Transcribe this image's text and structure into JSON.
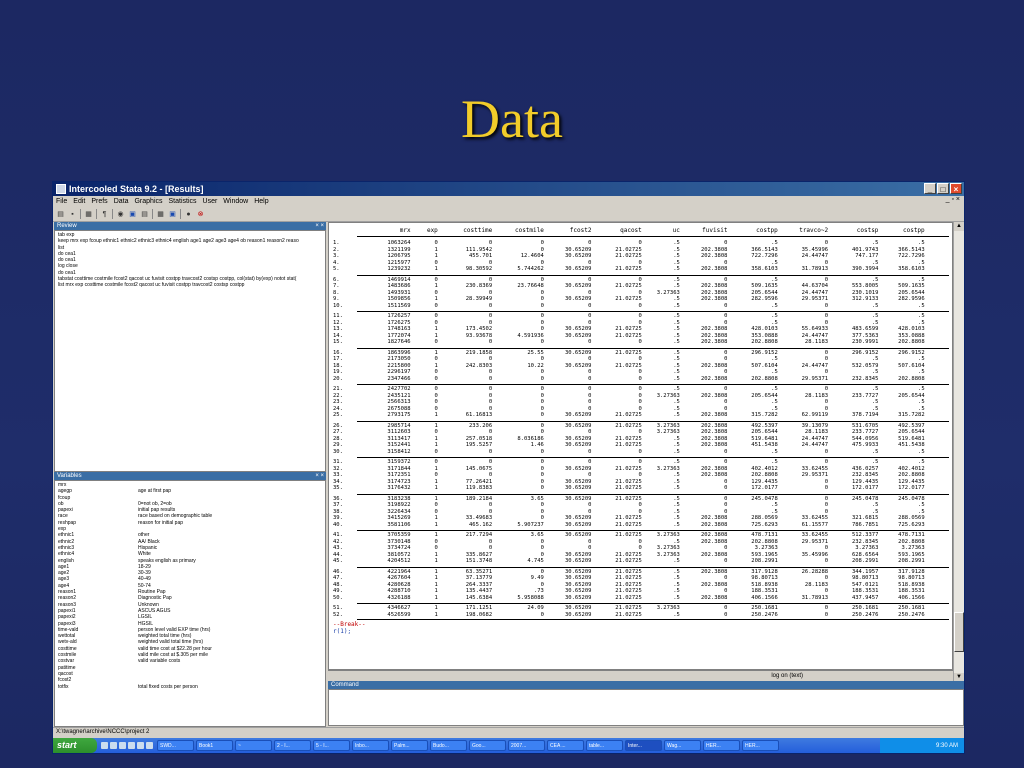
{
  "slide": {
    "title": "Data"
  },
  "window": {
    "title": "Intercooled Stata 9.2 - [Results]"
  },
  "menu": [
    "File",
    "Edit",
    "Prefs",
    "Data",
    "Graphics",
    "Statistics",
    "User",
    "Window",
    "Help"
  ],
  "review": {
    "title": "Review",
    "lines": [
      "tab exp",
      "keep mrx exp fcoup ethnic1 ethnic2 ethnic3 ethnic4 english age1 age2 age3 age4 ob reason1 reason2 reaso",
      "list",
      "do cea1",
      "do cea1",
      "log close",
      "do cea1",
      "tabstat costtime costmile fcost2 qacost uc fuvisit costpp travcost2 costsp costpp, col(stat) by(exp) notot stat(",
      "list mrx exp costtime costmile fcost2 qacost uc fuvisit costpp travcost2 costsp costpp"
    ]
  },
  "variables": {
    "title": "Variables",
    "rows": [
      [
        "mrx",
        ""
      ],
      [
        "agegp",
        "age at first pap"
      ],
      [
        "fcoup",
        ""
      ],
      [
        "ob",
        "0=not ob, 2=ob"
      ],
      [
        "papexi",
        "initial pap results"
      ],
      [
        "race",
        "race based on demographic table"
      ],
      [
        "reshpap",
        "reason for initial pap"
      ],
      [
        "exp",
        ""
      ],
      [
        "ethnic1",
        "other"
      ],
      [
        "ethnic2",
        "AA/ Black"
      ],
      [
        "ethnic3",
        "Hispanic"
      ],
      [
        "ethnic4",
        "White"
      ],
      [
        "english",
        "speaks english as primary"
      ],
      [
        "age1",
        "18-29"
      ],
      [
        "age2",
        "30-39"
      ],
      [
        "age3",
        "40-49"
      ],
      [
        "age4",
        "50-74"
      ],
      [
        "reason1",
        "Routine Pap"
      ],
      [
        "reason2",
        "Diagnostic Pap"
      ],
      [
        "reason3",
        "Unknown"
      ],
      [
        "papexi1",
        "ASCUS AGUS"
      ],
      [
        "papexi2",
        "LGSIL"
      ],
      [
        "papexi3",
        "HGSIL"
      ],
      [
        "time-vald",
        "person level valid EXP time (hrs)"
      ],
      [
        "wettotal",
        "weighted total time (hrs)"
      ],
      [
        "wetv-ald",
        "weighted valid total time (hrs)"
      ],
      [
        "costtime",
        "valid time cost at $22.28 per hour"
      ],
      [
        "costmile",
        "valid mile cost at $.305 per mile"
      ],
      [
        "costvar",
        "valid variable costs"
      ],
      [
        "patitime",
        ""
      ],
      [
        "qacost",
        ""
      ],
      [
        "fcost2",
        ""
      ],
      [
        "totfix",
        "total fixed costs per person"
      ]
    ]
  },
  "results": {
    "columns": [
      "mrx",
      "exp",
      "costtime",
      "costmile",
      "fcost2",
      "qacost",
      "uc",
      "fuvisit",
      "costpp",
      "travco~2",
      "costsp",
      "costpp"
    ],
    "rows": [
      [
        "1.",
        "1063264",
        "0",
        "0",
        "0",
        "0",
        "0",
        ".5",
        "0",
        ".5",
        "0",
        ".5",
        ".5"
      ],
      [
        "2.",
        "1321199",
        "1",
        "111.9542",
        "0",
        "30.65209",
        "21.02725",
        ".5",
        "202.3808",
        "366.5143",
        "35.45996",
        "401.9743",
        "366.5143"
      ],
      [
        "3.",
        "1206795",
        "1",
        "455.701",
        "12.4604",
        "30.65209",
        "21.02725",
        ".5",
        "202.3808",
        "722.7296",
        "24.44747",
        "747.177",
        "722.7296"
      ],
      [
        "4.",
        "1215977",
        "0",
        "0",
        "0",
        "0",
        "0",
        ".5",
        "0",
        ".5",
        "0",
        ".5",
        ".5"
      ],
      [
        "5.",
        "1239232",
        "1",
        "98.30592",
        "5.744262",
        "30.65209",
        "21.02725",
        ".5",
        "202.3808",
        "358.6103",
        "31.78913",
        "390.3994",
        "358.6103"
      ],
      [
        "6.",
        "1469914",
        "0",
        "0",
        "0",
        "0",
        "0",
        ".5",
        "0",
        ".5",
        "0",
        ".5",
        ".5"
      ],
      [
        "7.",
        "1483686",
        "1",
        "230.8369",
        "23.76648",
        "30.65209",
        "21.02725",
        ".5",
        "202.3808",
        "509.1635",
        "44.63704",
        "553.8005",
        "509.1635"
      ],
      [
        "8.",
        "1493931",
        "0",
        "0",
        "0",
        "0",
        "0",
        "3.27363",
        "202.3808",
        "205.6544",
        "24.44747",
        "230.1019",
        "205.6544"
      ],
      [
        "9.",
        "1509856",
        "1",
        "28.39949",
        "0",
        "30.65209",
        "21.02725",
        ".5",
        "202.3808",
        "282.9596",
        "29.95371",
        "312.9133",
        "282.9596"
      ],
      [
        "10.",
        "1511569",
        "0",
        "0",
        "0",
        "0",
        "0",
        ".5",
        "0",
        ".5",
        "0",
        ".5",
        ".5"
      ],
      [
        "11.",
        "1726257",
        "0",
        "0",
        "0",
        "0",
        "0",
        ".5",
        "0",
        ".5",
        "0",
        ".5",
        ".5"
      ],
      [
        "12.",
        "1726275",
        "0",
        "0",
        "0",
        "0",
        "0",
        ".5",
        "0",
        ".5",
        "0",
        ".5",
        ".5"
      ],
      [
        "13.",
        "1748163",
        "1",
        "173.4502",
        "0",
        "30.65209",
        "21.02725",
        ".5",
        "202.3808",
        "428.0103",
        "55.64933",
        "483.6599",
        "428.0103"
      ],
      [
        "14.",
        "1772074",
        "1",
        "93.93678",
        "4.591936",
        "30.65209",
        "21.02725",
        ".5",
        "202.3808",
        "353.0888",
        "24.44747",
        "377.5363",
        "353.0888"
      ],
      [
        "15.",
        "1827646",
        "0",
        "0",
        "0",
        "0",
        "0",
        ".5",
        "202.3808",
        "202.8808",
        "28.1183",
        "230.9991",
        "202.8808"
      ],
      [
        "16.",
        "1863996",
        "1",
        "219.1858",
        "25.55",
        "30.65209",
        "21.02725",
        ".5",
        "0",
        "296.9152",
        "0",
        "296.9152",
        "296.9152"
      ],
      [
        "17.",
        "2173050",
        "0",
        "0",
        "0",
        "0",
        "0",
        ".5",
        "0",
        ".5",
        "0",
        ".5",
        ".5"
      ],
      [
        "18.",
        "2215800",
        "1",
        "242.8303",
        "10.22",
        "30.65209",
        "21.02725",
        ".5",
        "202.3808",
        "507.6104",
        "24.44747",
        "532.0579",
        "507.6104"
      ],
      [
        "19.",
        "2296197",
        "0",
        "0",
        "0",
        "0",
        "0",
        ".5",
        "0",
        ".5",
        "0",
        ".5",
        ".5"
      ],
      [
        "20.",
        "2347466",
        "0",
        "0",
        "0",
        "0",
        "0",
        ".5",
        "202.3808",
        "202.8808",
        "29.95371",
        "232.8345",
        "202.8808"
      ],
      [
        "21.",
        "2427702",
        "0",
        "0",
        "0",
        "0",
        "0",
        ".5",
        "0",
        ".5",
        "0",
        ".5",
        ".5"
      ],
      [
        "22.",
        "2435121",
        "0",
        "0",
        "0",
        "0",
        "0",
        "3.27363",
        "202.3808",
        "205.6544",
        "28.1183",
        "233.7727",
        "205.6544"
      ],
      [
        "23.",
        "2566313",
        "0",
        "0",
        "0",
        "0",
        "0",
        ".5",
        "0",
        ".5",
        "0",
        ".5",
        ".5"
      ],
      [
        "24.",
        "2675088",
        "0",
        "0",
        "0",
        "0",
        "0",
        ".5",
        "0",
        ".5",
        "0",
        ".5",
        ".5"
      ],
      [
        "25.",
        "2793175",
        "1",
        "61.16813",
        "0",
        "30.65209",
        "21.02725",
        ".5",
        "202.3808",
        "315.7282",
        "62.99119",
        "378.7194",
        "315.7282"
      ],
      [
        "26.",
        "2985714",
        "1",
        "233.206",
        "0",
        "30.65209",
        "21.02725",
        "3.27363",
        "202.3808",
        "492.5397",
        "39.13079",
        "531.6705",
        "492.5397"
      ],
      [
        "27.",
        "3112603",
        "0",
        "0",
        "0",
        "0",
        "0",
        "3.27363",
        "202.3808",
        "205.6544",
        "28.1183",
        "233.7727",
        "205.6544"
      ],
      [
        "28.",
        "3113417",
        "1",
        "257.0518",
        "8.036186",
        "30.65209",
        "21.02725",
        ".5",
        "202.3808",
        "519.6481",
        "24.44747",
        "544.0956",
        "519.6481"
      ],
      [
        "29.",
        "3152441",
        "1",
        "195.5257",
        "1.46",
        "30.65209",
        "21.02725",
        ".5",
        "202.3808",
        "451.5438",
        "24.44747",
        "475.9933",
        "451.5438"
      ],
      [
        "30.",
        "3158412",
        "0",
        "0",
        "0",
        "0",
        "0",
        ".5",
        "0",
        ".5",
        "0",
        ".5",
        ".5"
      ],
      [
        "31.",
        "3159372",
        "0",
        "0",
        "0",
        "0",
        "0",
        ".5",
        "0",
        ".5",
        "0",
        ".5",
        ".5"
      ],
      [
        "32.",
        "3171844",
        "1",
        "145.0675",
        "0",
        "30.65209",
        "21.02725",
        "3.27363",
        "202.3808",
        "402.4012",
        "33.62455",
        "436.0257",
        "402.4012"
      ],
      [
        "33.",
        "3172351",
        "0",
        "0",
        "0",
        "0",
        "0",
        ".5",
        "202.3808",
        "202.8808",
        "29.95371",
        "232.8345",
        "202.8808"
      ],
      [
        "34.",
        "3174723",
        "1",
        "77.26421",
        "0",
        "30.65209",
        "21.02725",
        ".5",
        "0",
        "129.4435",
        "0",
        "129.4435",
        "129.4435"
      ],
      [
        "35.",
        "3176432",
        "1",
        "119.8383",
        "0",
        "30.65209",
        "21.02725",
        ".5",
        "0",
        "172.0177",
        "0",
        "172.0177",
        "172.0177"
      ],
      [
        "36.",
        "3183238",
        "1",
        "189.2184",
        "3.65",
        "30.65209",
        "21.02725",
        ".5",
        "0",
        "245.0478",
        "0",
        "245.0478",
        "245.0478"
      ],
      [
        "37.",
        "3198922",
        "0",
        "0",
        "0",
        "0",
        "0",
        ".5",
        "0",
        ".5",
        "0",
        ".5",
        ".5"
      ],
      [
        "38.",
        "3226434",
        "0",
        "0",
        "0",
        "0",
        "0",
        ".5",
        "0",
        ".5",
        "0",
        ".5",
        ".5"
      ],
      [
        "39.",
        "3415269",
        "1",
        "33.49683",
        "0",
        "30.65209",
        "21.02725",
        ".5",
        "202.3808",
        "288.0569",
        "33.62455",
        "321.6815",
        "288.0569"
      ],
      [
        "40.",
        "3581106",
        "1",
        "465.162",
        "5.907237",
        "30.65209",
        "21.02725",
        ".5",
        "202.3808",
        "725.6293",
        "61.15577",
        "786.7851",
        "725.6293"
      ],
      [
        "41.",
        "3705359",
        "1",
        "217.7294",
        "3.65",
        "30.65209",
        "21.02725",
        "3.27363",
        "202.3808",
        "478.7131",
        "33.62455",
        "512.3377",
        "478.7131"
      ],
      [
        "42.",
        "3730148",
        "0",
        "0",
        "0",
        "0",
        "0",
        ".5",
        "202.3808",
        "202.8808",
        "29.95371",
        "232.8345",
        "202.8808"
      ],
      [
        "43.",
        "3734724",
        "0",
        "0",
        "0",
        "0",
        "0",
        "3.27363",
        "0",
        "3.27363",
        "0",
        "3.27363",
        "3.27363"
      ],
      [
        "44.",
        "3810572",
        "1",
        "335.8627",
        "0",
        "30.65209",
        "21.02725",
        "3.27363",
        "202.3808",
        "593.1965",
        "35.45996",
        "628.6564",
        "593.1965"
      ],
      [
        "45.",
        "4204512",
        "1",
        "151.3748",
        "4.745",
        "30.65209",
        "21.02725",
        ".5",
        "0",
        "208.2991",
        "0",
        "208.2991",
        "208.2991"
      ],
      [
        "46.",
        "4221964",
        "1",
        "63.35271",
        "0",
        "30.65209",
        "21.02725",
        ".5",
        "202.3808",
        "317.9128",
        "26.28288",
        "344.1957",
        "317.9128"
      ],
      [
        "47.",
        "4267604",
        "1",
        "37.13779",
        "9.49",
        "30.65209",
        "21.02725",
        ".5",
        "0",
        "98.80713",
        "0",
        "98.80713",
        "98.80713"
      ],
      [
        "48.",
        "4280628",
        "1",
        "264.3337",
        "0",
        "30.65209",
        "21.02725",
        ".5",
        "202.3808",
        "518.8938",
        "28.1183",
        "547.0121",
        "518.8938"
      ],
      [
        "49.",
        "4288710",
        "1",
        "135.4437",
        ".73",
        "30.65209",
        "21.02725",
        ".5",
        "0",
        "188.3531",
        "0",
        "188.3531",
        "188.3531"
      ],
      [
        "50.",
        "4326188",
        "1",
        "145.6384",
        "5.958088",
        "30.65209",
        "21.02725",
        ".5",
        "202.3808",
        "406.1566",
        "31.78913",
        "437.9457",
        "406.1566"
      ],
      [
        "51.",
        "4346627",
        "1",
        "171.1251",
        "24.09",
        "30.65209",
        "21.02725",
        "3.27363",
        "0",
        "250.1681",
        "0",
        "250.1681",
        "250.1681"
      ],
      [
        "52.",
        "4526599",
        "1",
        "198.0682",
        "0",
        "30.65209",
        "21.02725",
        ".5",
        "0",
        "250.2476",
        "0",
        "250.2476",
        "250.2476"
      ]
    ],
    "break_text": "--Break--",
    "r_text": "r(1);"
  },
  "status": {
    "log": "log on (text)"
  },
  "command": {
    "title": "Command"
  },
  "path": "X:\\twagner\\archive\\NCCC\\project 2",
  "taskbar": {
    "start": "start",
    "tasks": [
      "SWD...",
      "Book1",
      "~",
      "2 - I...",
      "5 - I...",
      "Inbo...",
      "Palm...",
      "Budo...",
      "Goo...",
      "2007...",
      "CEA ...",
      "table...",
      "Inter...",
      "Wag...",
      "HER...",
      "HER..."
    ],
    "active_index": 12,
    "clock": "9:30 AM"
  }
}
